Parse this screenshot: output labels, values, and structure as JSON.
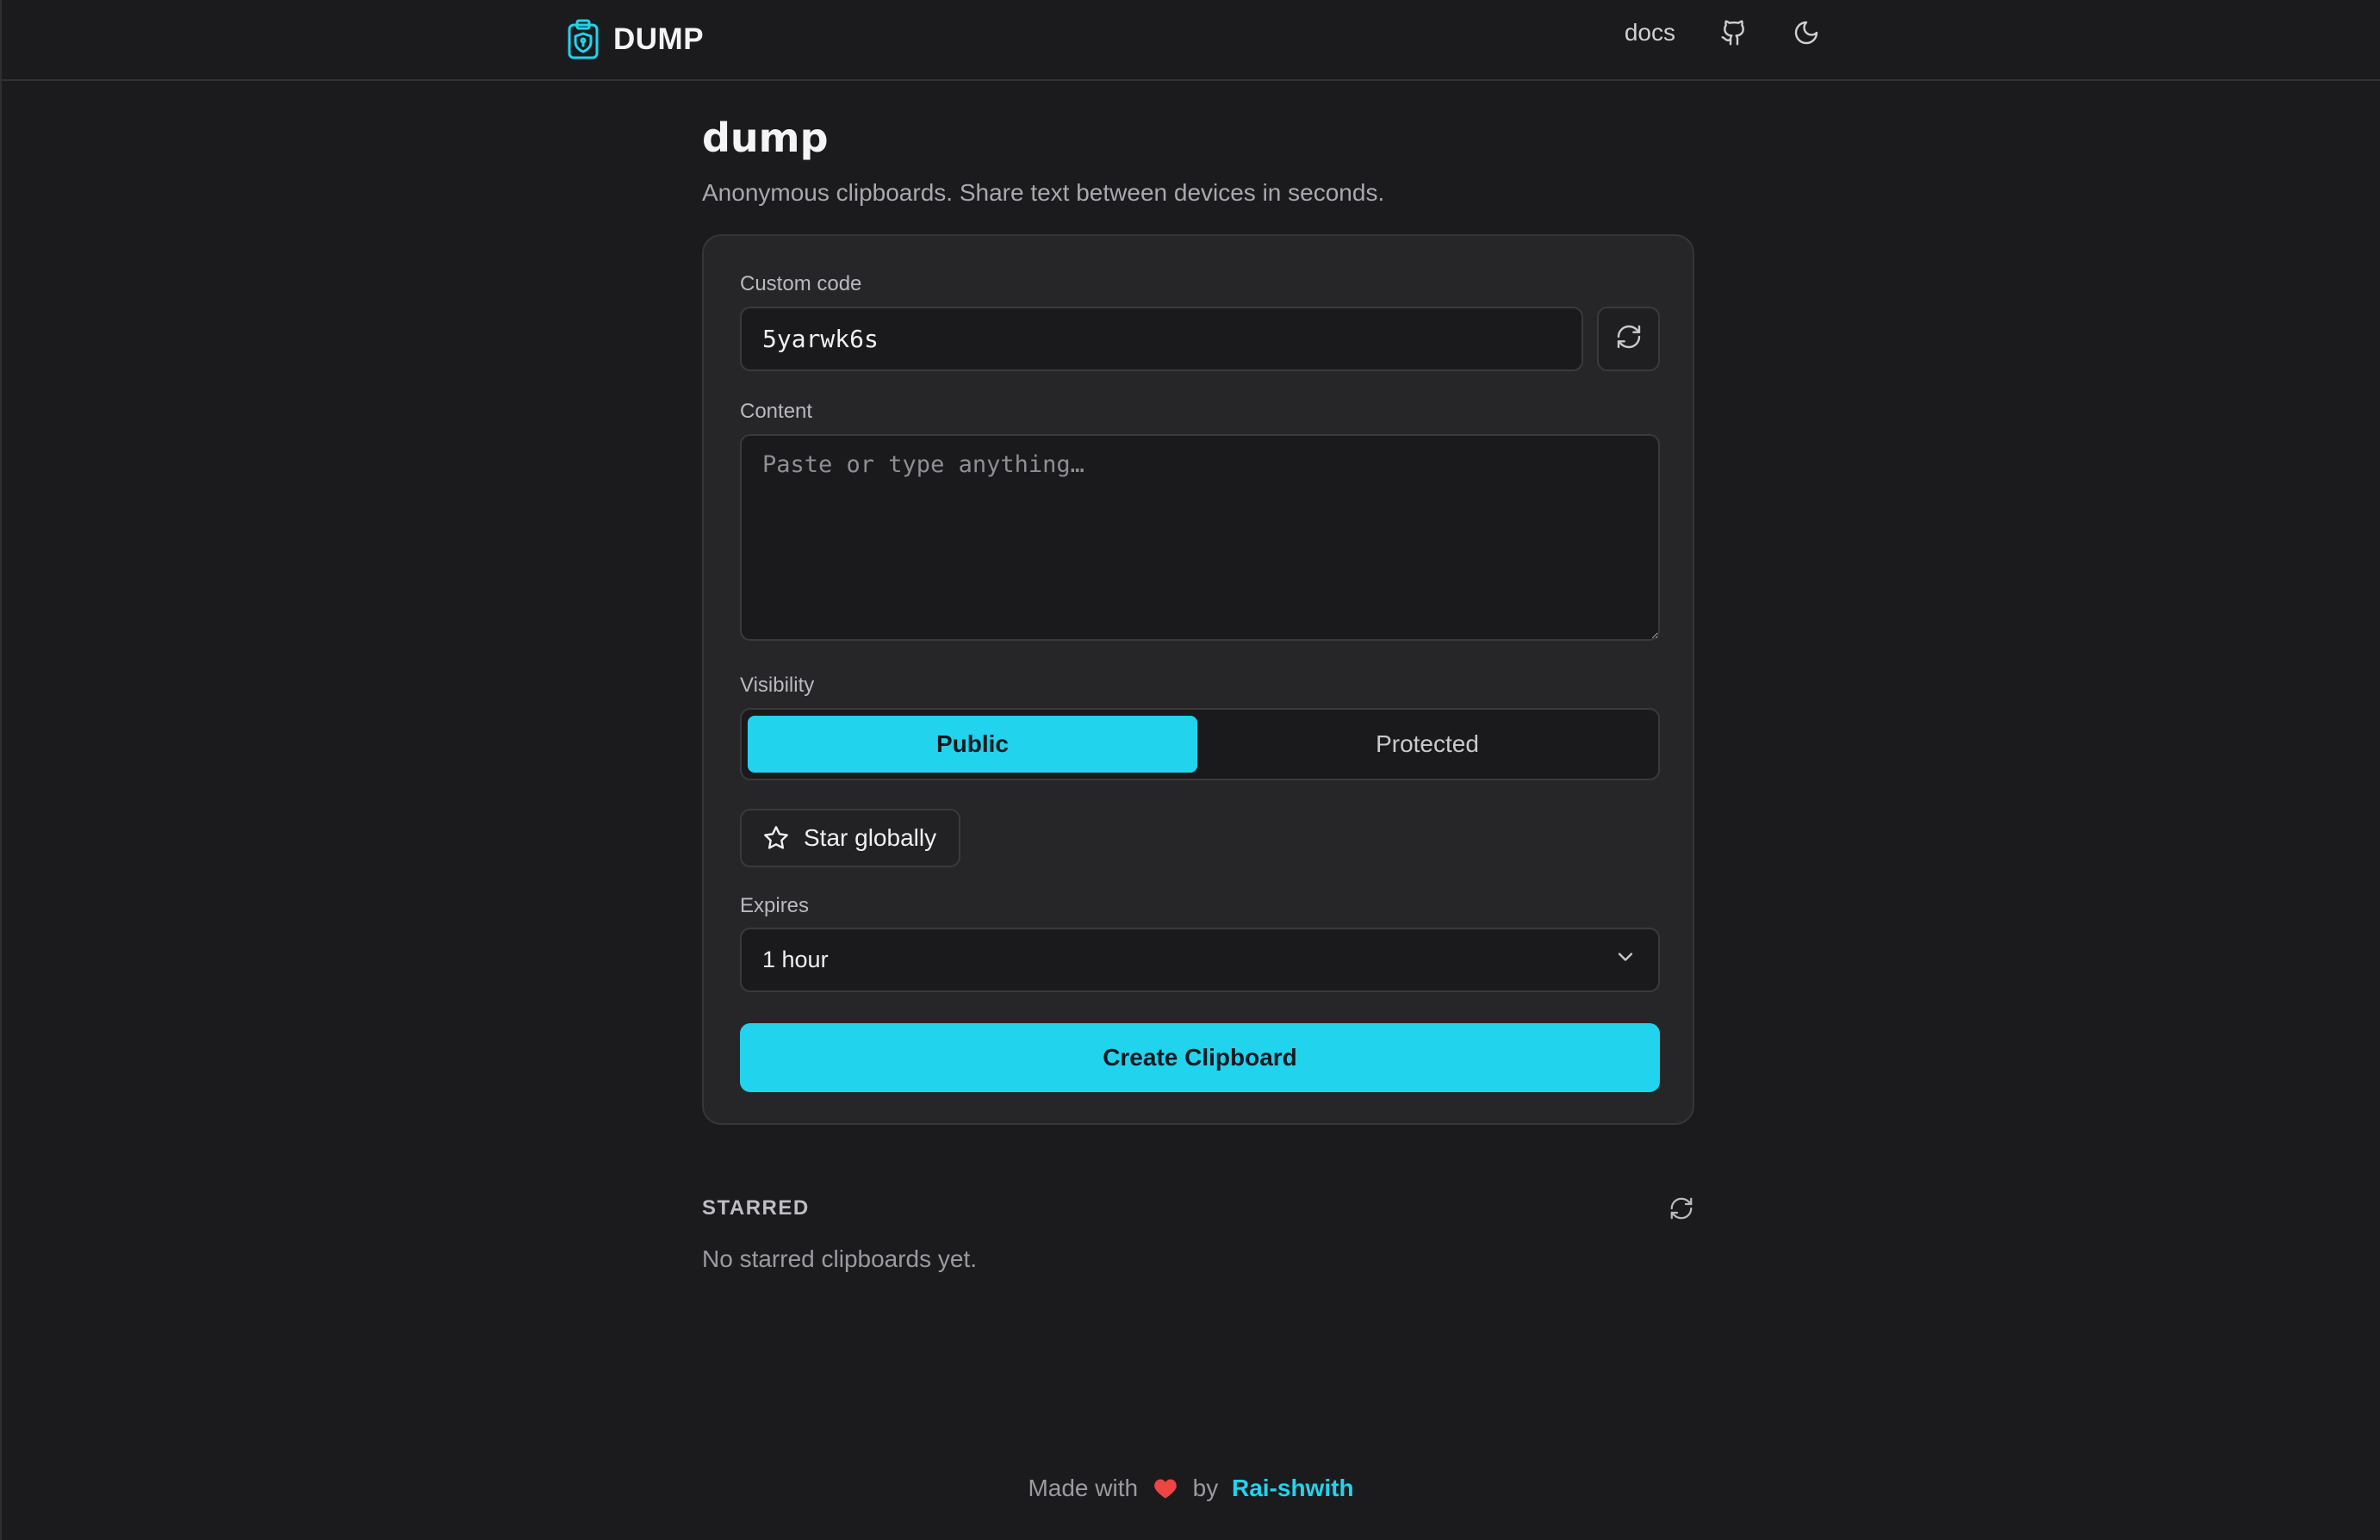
{
  "header": {
    "brand": "DUMP",
    "nav": {
      "docs": "docs"
    },
    "icons": {
      "logo": "clipboard-shield-icon",
      "github": "github-icon",
      "theme": "moon-icon"
    }
  },
  "main": {
    "title": "dump",
    "subtitle": "Anonymous clipboards. Share text between devices in seconds."
  },
  "form": {
    "custom_code_label": "Custom code",
    "custom_code_value": "5yarwk6s",
    "content_label": "Content",
    "content_placeholder": "Paste or type anything…",
    "visibility_label": "Visibility",
    "visibility_options": [
      "Public",
      "Protected"
    ],
    "visibility_selected": "Public",
    "star_label": "Star globally",
    "expires_label": "Expires",
    "expires_value": "1 hour",
    "create_label": "Create Clipboard"
  },
  "starred": {
    "title": "STARRED",
    "empty": "No starred clipboards yet."
  },
  "footer": {
    "made_with": "Made with",
    "by": "by",
    "author": "Rai-shwith"
  },
  "colors": {
    "accent": "#22d3ee",
    "heart": "#ef4444",
    "background": "#1b1b1d",
    "card": "#262629"
  }
}
